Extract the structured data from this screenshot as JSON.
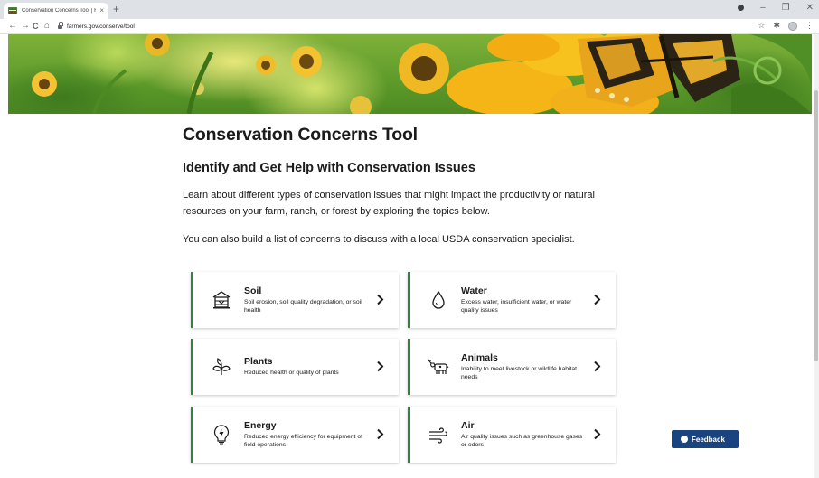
{
  "browser": {
    "tab_title": "Conservation Concerns Tool | Fa",
    "tab_close": "×",
    "new_tab": "+",
    "url": "farmers.gov/conserve/tool",
    "minimize": "–",
    "maximize": "❐",
    "close": "✕",
    "back": "←",
    "forward": "→",
    "reload": "C",
    "home": "⌂",
    "star": "☆",
    "extensions": "✱",
    "menu": "⋮"
  },
  "page": {
    "title": "Conservation Concerns Tool",
    "subtitle": "Identify and Get Help with Conservation Issues",
    "intro": "Learn about different types of conservation issues that might impact the productivity or natural resources on your farm, ranch, or forest by exploring the topics below.",
    "intro2": "You can also build a list of concerns to discuss with a local USDA conservation specialist."
  },
  "topics": [
    {
      "title": "Soil",
      "desc": "Soil erosion, soil quality degradation, or soil health",
      "icon": "soil-icon"
    },
    {
      "title": "Water",
      "desc": "Excess water, insufficient water, or water quality issues",
      "icon": "water-drop-icon"
    },
    {
      "title": "Plants",
      "desc": "Reduced health or quality of plants",
      "icon": "plant-icon"
    },
    {
      "title": "Animals",
      "desc": "Inability to meet livestock or wildlife habitat needs",
      "icon": "cow-icon"
    },
    {
      "title": "Energy",
      "desc": "Reduced energy efficiency for equipment of field operations",
      "icon": "energy-icon"
    },
    {
      "title": "Air",
      "desc": "Air quality issues such as greenhouse gases or odors",
      "icon": "wind-icon"
    }
  ],
  "feedback": {
    "label": "Feedback"
  },
  "colors": {
    "accent": "#2e8540",
    "feedback_bg": "#1a4480",
    "text": "#1b1b1b"
  }
}
